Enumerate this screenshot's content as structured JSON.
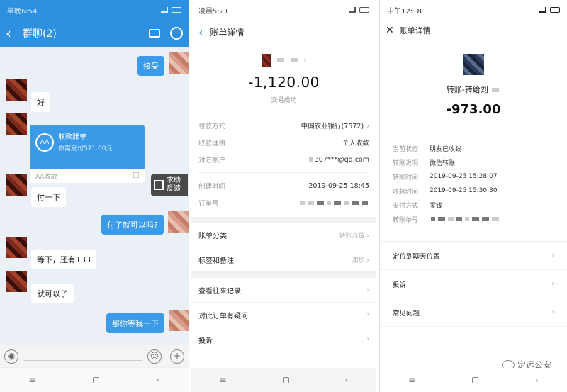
{
  "panel1": {
    "status_time": "早晚6:54",
    "title": "群聊(2)",
    "msg_accept": "接受",
    "msg_ok": "好",
    "card_title": "收款账单",
    "card_sub": "你需支付571.00元",
    "card_foot": "AA收款",
    "help_line1": "求助",
    "help_line2": "反馈",
    "msg_payone": "付一下",
    "msg_canpay": "付了就可以吗?",
    "msg_wait": "等下，还有133",
    "msg_ok2": "就可以了",
    "msg_waitme": "那你等我一下",
    "icons": [
      "back-icon",
      "speaker-icon",
      "person-icon",
      "voice-icon",
      "emoji-icon",
      "plus-icon"
    ],
    "accent": "#2e90e0"
  },
  "panel2": {
    "status_time": "凌晨5:21",
    "title": "账单详情",
    "amount": "-1,120.00",
    "status": "交易成功",
    "rows": [
      {
        "label": "付款方式",
        "value": "中国农业银行(7572)",
        "chev": "›"
      },
      {
        "label": "收款理由",
        "value": "个人收款",
        "chev": ""
      },
      {
        "label": "对方账户",
        "value": "307***@qq.com",
        "chev": ""
      }
    ],
    "created_label": "创建时间",
    "created_value": "2019-09-25 18:45",
    "order_label": "订单号",
    "menu1_label": "账单分类",
    "menu1_right": "转账充值",
    "menu2_label": "标签和备注",
    "menu2_right": "添加",
    "menu3_label": "查看往来记录",
    "menu4_label": "对此订单有疑问",
    "menu5_label": "投诉"
  },
  "panel3": {
    "status_time": "中午12:18",
    "title": "账单详情",
    "heading": "转账-转给刘",
    "amount": "-973.00",
    "details": [
      {
        "label": "当前状态",
        "value": "朋友已收钱"
      },
      {
        "label": "转账说明",
        "value": "微信转账"
      },
      {
        "label": "转账时间",
        "value": "2019-09-25 15:28:07"
      },
      {
        "label": "收款时间",
        "value": "2019-09-25 15:30:30"
      },
      {
        "label": "支付方式",
        "value": "零钱"
      }
    ],
    "txid_label": "转账单号",
    "menu1": "定位到聊天位置",
    "menu2": "投诉",
    "menu3": "常见问题",
    "watermark": "定远公安"
  }
}
